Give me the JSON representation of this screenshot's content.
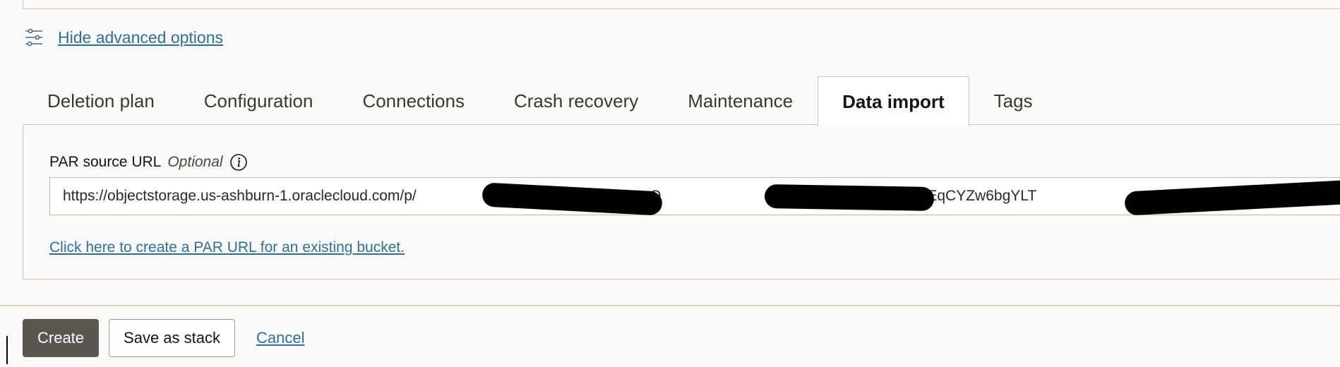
{
  "advanced_toggle": {
    "icon": "sliders-icon",
    "label": "Hide advanced options"
  },
  "tabs": [
    {
      "label": "Deletion plan",
      "active": false
    },
    {
      "label": "Configuration",
      "active": false
    },
    {
      "label": "Connections",
      "active": false
    },
    {
      "label": "Crash recovery",
      "active": false
    },
    {
      "label": "Maintenance",
      "active": false
    },
    {
      "label": "Data import",
      "active": true
    },
    {
      "label": "Tags",
      "active": false
    }
  ],
  "data_import": {
    "field_label": "PAR source URL",
    "optional_label": "Optional",
    "info_icon": "info-icon",
    "url_value": "https://objectstorage.us-ashburn-1.oraclecloud.com/p/                              R06dJKa5ceu4gQ                                                 -oc2026NEqCYZw6bgYLT                                                it/storage",
    "create_par_link": "Click here to create a PAR URL for an existing bucket."
  },
  "footer": {
    "create_label": "Create",
    "save_stack_label": "Save as stack",
    "cancel_label": "Cancel"
  },
  "colors": {
    "link": "#2d6fa1",
    "primary_button": "#5b5650",
    "background": "#fbfaf8",
    "border": "#c9c6c1"
  }
}
